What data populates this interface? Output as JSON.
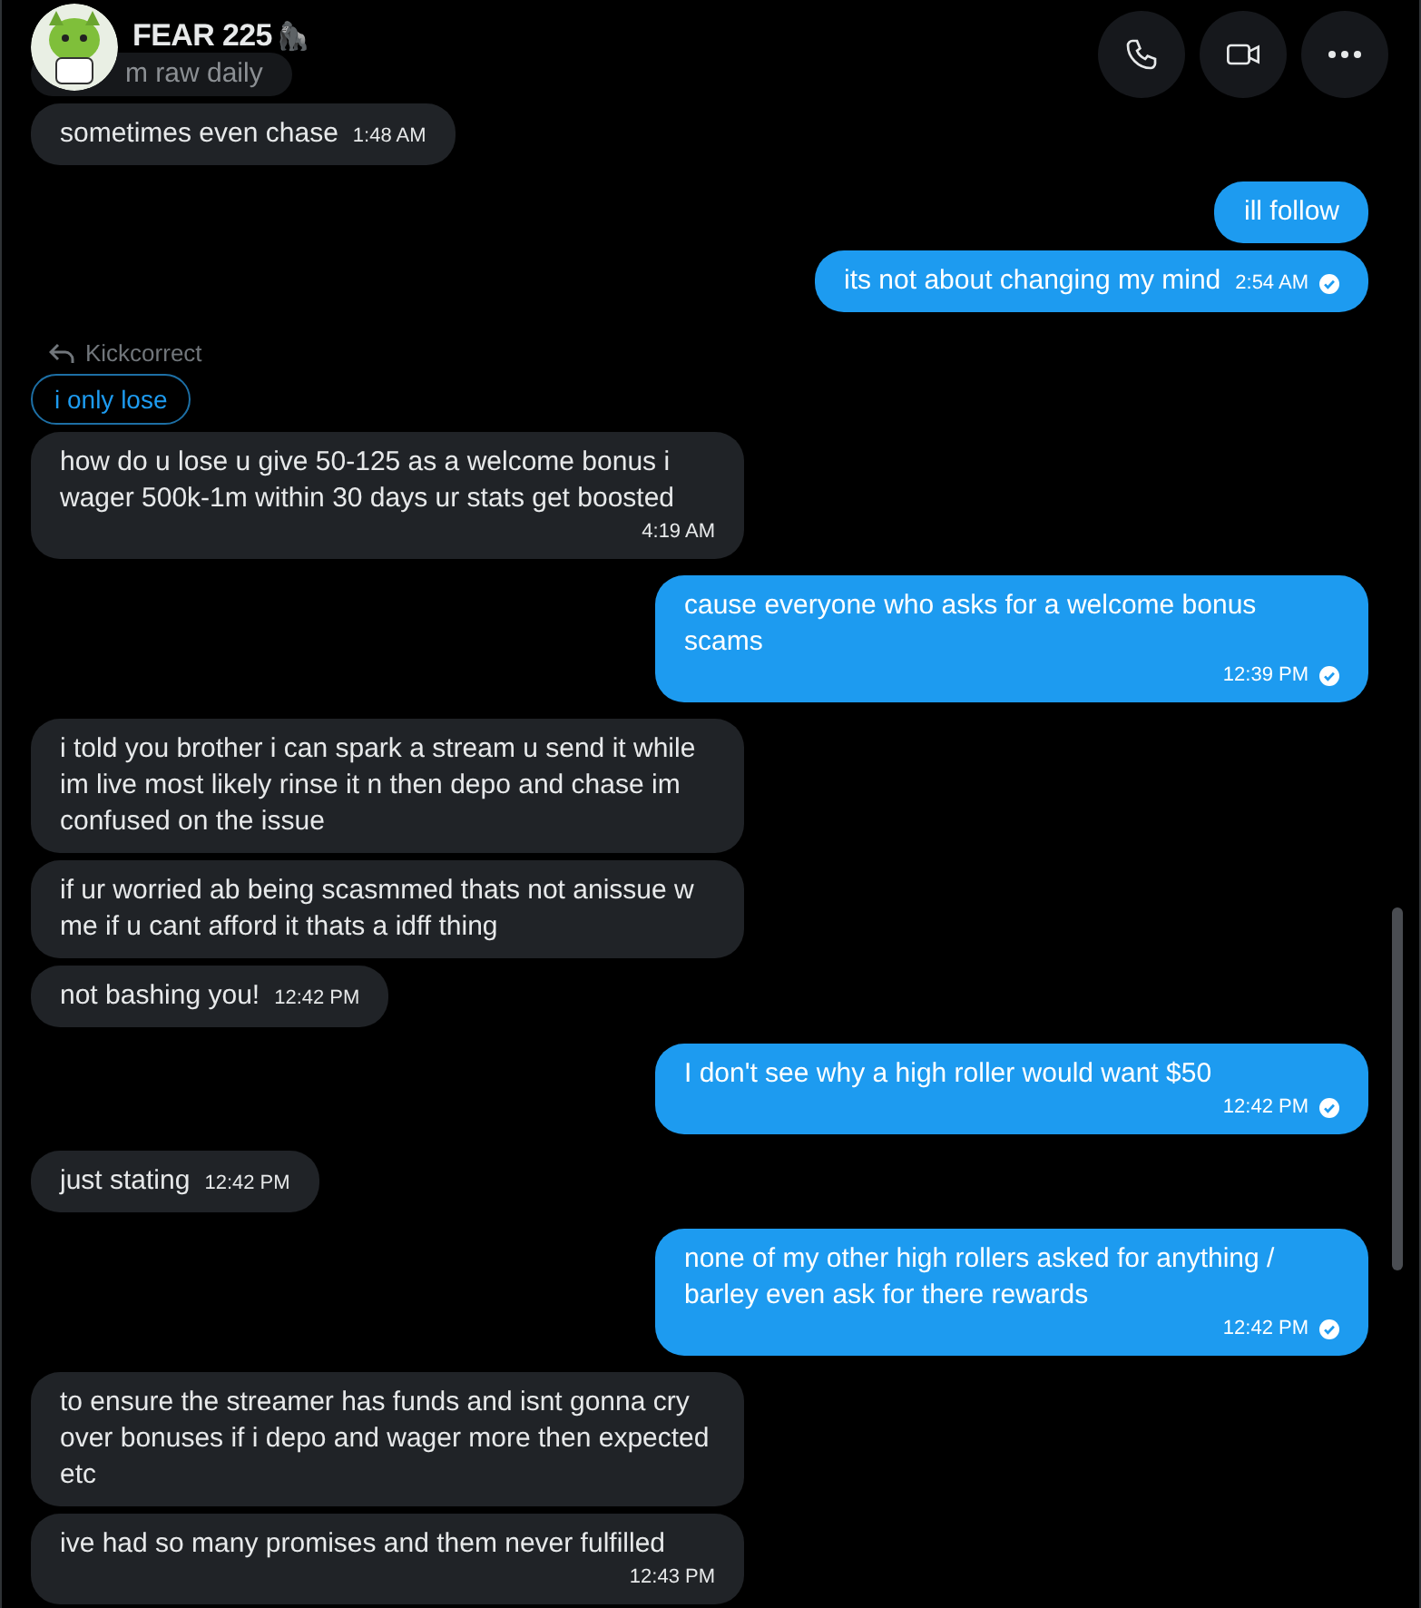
{
  "header": {
    "name": "FEAR 225",
    "emoji": "🦍"
  },
  "groups": [
    {
      "kind": "in",
      "messages": [
        {
          "text": "m raw daily",
          "partial": true
        },
        {
          "text": "sometimes even chase",
          "time": "1:48 AM"
        }
      ]
    },
    {
      "kind": "out",
      "messages": [
        {
          "text": "ill follow"
        },
        {
          "text": "its not about changing my mind",
          "time": "2:54 AM",
          "read": true
        }
      ]
    },
    {
      "kind": "in",
      "reply": {
        "author": "Kickcorrect",
        "quote": "i only lose"
      },
      "messages": [
        {
          "text": "how do u lose u give 50-125 as a welcome bonus i wager 500k-1m within 30 days ur stats get boosted",
          "time": "4:19 AM"
        }
      ]
    },
    {
      "kind": "out",
      "messages": [
        {
          "text": "cause everyone who asks for a welcome bonus scams",
          "time": "12:39 PM",
          "read": true
        }
      ]
    },
    {
      "kind": "in",
      "messages": [
        {
          "text": "i told you brother i can spark a stream u send it while im live most likely rinse it n then depo and chase im confused on the issue"
        },
        {
          "text": "if ur worried ab being scasmmed thats not anissue w me if u cant afford it thats a idff thing"
        },
        {
          "text": "not bashing you!",
          "time": "12:42 PM"
        }
      ]
    },
    {
      "kind": "out",
      "messages": [
        {
          "text": "I don't see why a high roller would want $50",
          "time": "12:42 PM",
          "read": true
        }
      ]
    },
    {
      "kind": "in",
      "messages": [
        {
          "text": "just stating",
          "time": "12:42 PM"
        }
      ]
    },
    {
      "kind": "out",
      "messages": [
        {
          "text": "none of my other high rollers asked for anything / barley even ask for there rewards",
          "time": "12:42 PM",
          "read": true
        }
      ]
    },
    {
      "kind": "in",
      "messages": [
        {
          "text": "to ensure the streamer has funds and isnt gonna cry over bonuses if i depo and wager more then expected etc"
        },
        {
          "text": "ive had so many promises and them never fulfilled",
          "time": "12:43 PM"
        }
      ]
    }
  ]
}
